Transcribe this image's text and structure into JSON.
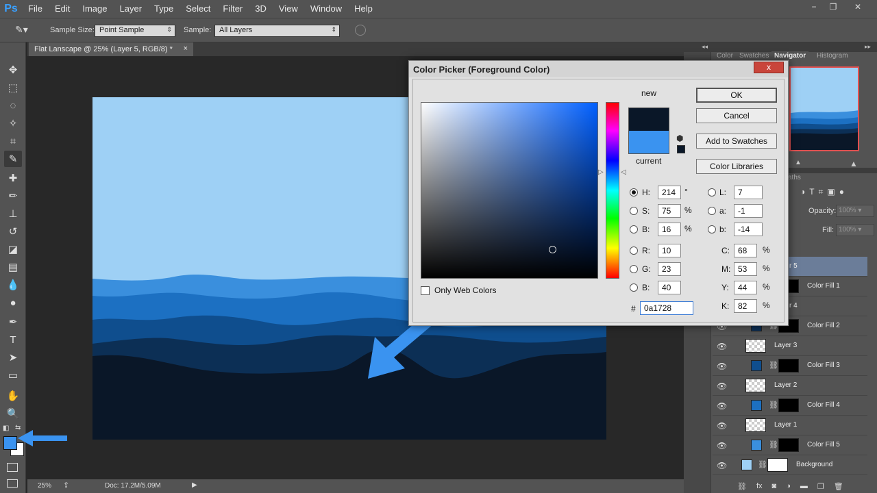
{
  "app": {
    "logo": "Ps"
  },
  "menu": [
    "File",
    "Edit",
    "Image",
    "Layer",
    "Type",
    "Select",
    "Filter",
    "3D",
    "View",
    "Window",
    "Help"
  ],
  "window_controls": {
    "minimize": "−",
    "restore": "❐",
    "close": "✕"
  },
  "options": {
    "sample_size_label": "Sample Size:",
    "sample_size_value": "Point Sample",
    "sample_label": "Sample:",
    "sample_value": "All Layers"
  },
  "document": {
    "tab_title": "Flat Lanscape @ 25% (Layer 5, RGB/8) *",
    "close": "×"
  },
  "status": {
    "zoom": "25%",
    "doc": "Doc: 17.2M/5.09M"
  },
  "panels": {
    "top_tabs": [
      "Color",
      "Swatches",
      "Navigator",
      "Histogram"
    ],
    "active_top_tab": "Navigator",
    "layers_tab_fragment": "aths",
    "opacity_label": "Opacity:",
    "opacity_value": "100%",
    "fill_label": "Fill:",
    "fill_value": "100%"
  },
  "layers": [
    {
      "name": "r 5",
      "type": "selected"
    },
    {
      "name": "Color Fill 1",
      "type": "fill",
      "color": "#0a1728"
    },
    {
      "name": "r 4",
      "type": "layer"
    },
    {
      "name": "Color Fill 2",
      "type": "fill",
      "color": "#0c2f55"
    },
    {
      "name": "Layer 3",
      "type": "layer"
    },
    {
      "name": "Color Fill 3",
      "type": "fill",
      "color": "#0f4e8e"
    },
    {
      "name": "Layer 2",
      "type": "layer"
    },
    {
      "name": "Color Fill 4",
      "type": "fill",
      "color": "#1c70c2"
    },
    {
      "name": "Layer 1",
      "type": "layer"
    },
    {
      "name": "Color Fill 5",
      "type": "fill",
      "color": "#3a8fdd"
    },
    {
      "name": "Background",
      "type": "background",
      "color": "#9ed0f5"
    }
  ],
  "dialog": {
    "title": "Color Picker (Foreground Color)",
    "close": "x",
    "new_label": "new",
    "current_label": "current",
    "new_color": "#0a1728",
    "current_color": "#3a93f0",
    "buttons": {
      "ok": "OK",
      "cancel": "Cancel",
      "add_swatches": "Add to Swatches",
      "libraries": "Color Libraries"
    },
    "only_web_colors": "Only Web Colors",
    "hsb": [
      {
        "label": "H:",
        "value": "214",
        "unit": "°",
        "selected": true
      },
      {
        "label": "S:",
        "value": "75",
        "unit": "%",
        "selected": false
      },
      {
        "label": "B:",
        "value": "16",
        "unit": "%",
        "selected": false
      }
    ],
    "rgb": [
      {
        "label": "R:",
        "value": "10"
      },
      {
        "label": "G:",
        "value": "23"
      },
      {
        "label": "B:",
        "value": "40"
      }
    ],
    "lab": [
      {
        "label": "L:",
        "value": "7"
      },
      {
        "label": "a:",
        "value": "-1"
      },
      {
        "label": "b:",
        "value": "-14"
      }
    ],
    "cmyk": [
      {
        "label": "C:",
        "value": "68",
        "unit": "%"
      },
      {
        "label": "M:",
        "value": "53",
        "unit": "%"
      },
      {
        "label": "Y:",
        "value": "44",
        "unit": "%"
      },
      {
        "label": "K:",
        "value": "82",
        "unit": "%"
      }
    ],
    "hex_label": "#",
    "hex_value": "0a1728"
  },
  "colors": {
    "accent_arrow": "#3a93f0",
    "foreground": "#3a93f0",
    "background": "#ffffff"
  }
}
